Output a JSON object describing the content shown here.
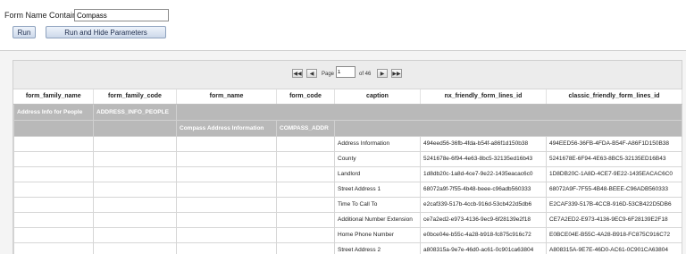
{
  "params": {
    "label": "Form Name Contains",
    "value": "Compass",
    "run_label": "Run",
    "run_hide_label": "Run and Hide Parameters"
  },
  "pager": {
    "first_icon": "first-page-icon",
    "prev_icon": "prev-page-icon",
    "next_icon": "next-page-icon",
    "last_icon": "last-page-icon",
    "page_label": "Page",
    "page_value": "1",
    "of_text": "of 46"
  },
  "columns": [
    "form_family_name",
    "form_family_code",
    "form_name",
    "form_code",
    "caption",
    "nx_friendly_form_lines_id",
    "classic_friendly_form_lines_id"
  ],
  "group1": {
    "family_name": "Address Info for People",
    "family_code": "ADDRESS_INFO_PEOPLE"
  },
  "group2": {
    "form_name": "Compass Address Information",
    "form_code": "COMPASS_ADDR"
  },
  "rows": [
    {
      "caption": "Address Information",
      "nx": "494eed56-36fb-4fda-b54f-a86f1d150b38",
      "classic": "494EED56-36FB-4FDA-B54F-A86F1D150B38"
    },
    {
      "caption": "County",
      "nx": "5241678e-6f94-4e63-8bc5-32135ed16b43",
      "classic": "5241678E-6F94-4E63-8BC5-32135ED16B43"
    },
    {
      "caption": "Landlord",
      "nx": "1d8db20c-1a8d-4ce7-9e22-1435eacac6c0",
      "classic": "1D8DB20C-1A8D-4CE7-9E22-1435EACAC6C0"
    },
    {
      "caption": "Street Address 1",
      "nx": "68072a9f-7f55-4b48-beee-c96adb560333",
      "classic": "68072A9F-7F55-4B48-BEEE-C96ADB560333"
    },
    {
      "caption": "Time To Call To",
      "nx": "e2caf339-517b-4ccb-916d-53cb422d5db6",
      "classic": "E2CAF339-517B-4CCB-916D-53CB422D5DB6"
    },
    {
      "caption": "Additional Number Extension",
      "nx": "ce7a2ed2-e973-4136-9ec9-6f28139e2f18",
      "classic": "CE7A2ED2-E973-4136-9EC9-6F28139E2F18"
    },
    {
      "caption": "Home Phone Number",
      "nx": "e0bce04e-b55c-4a28-b918-fc875c916c72",
      "classic": "E0BCE04E-B55C-4A28-B918-FC875C916C72"
    },
    {
      "caption": "Street Address 2",
      "nx": "a808315a-9e7e-46d0-ac61-0c901ca63804",
      "classic": "A808315A-9E7E-46D0-AC61-0C901CA63804"
    }
  ]
}
